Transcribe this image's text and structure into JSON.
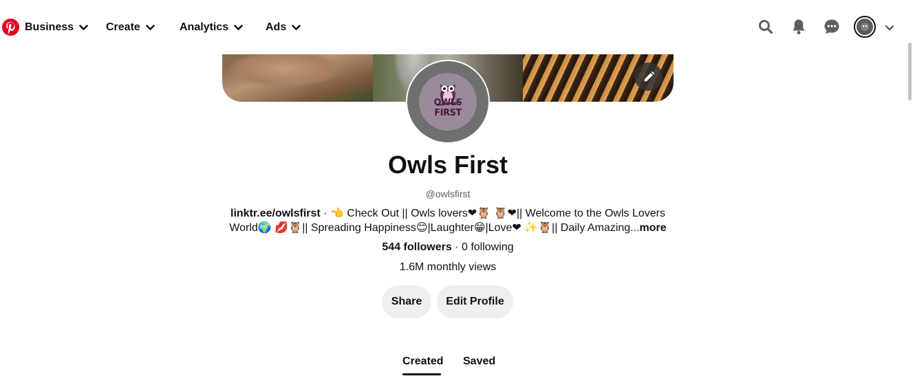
{
  "nav": {
    "logo_icon": "pinterest-logo-icon",
    "brand_color": "#e60023",
    "items": [
      {
        "label": "Business"
      },
      {
        "label": "Create"
      },
      {
        "label": "Analytics"
      },
      {
        "label": "Ads"
      }
    ],
    "icons": [
      "search-icon",
      "bell-icon",
      "messages-icon",
      "account-avatar",
      "chevron-down-icon"
    ]
  },
  "cover": {
    "edit_icon": "pencil-icon"
  },
  "profile": {
    "avatar_text": "OWLS FIRST",
    "name": "Owls First",
    "handle": "@owlsfirst",
    "bio_link": "linktr.ee/owlsfirst",
    "bio_text": " · 👈 Check Out || Owls lovers❤🦉 🦉❤|| Welcome to the Owls Lovers World🌍 💋🦉|| Spreading Happiness😊|Laughter😁|Love❤ ✨🦉|| Daily Amazing...",
    "bio_more": "more",
    "followers": "544 followers",
    "stats_separator": " · ",
    "following": "0 following",
    "monthly_views": "1.6M monthly views"
  },
  "actions": {
    "share_label": "Share",
    "edit_label": "Edit Profile"
  },
  "tabs": [
    {
      "label": "Created",
      "active": true
    },
    {
      "label": "Saved",
      "active": false
    }
  ]
}
